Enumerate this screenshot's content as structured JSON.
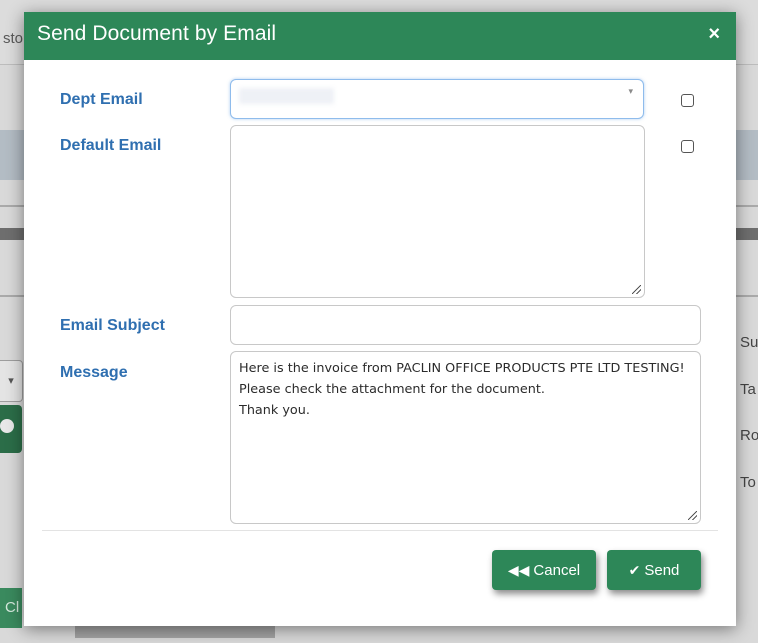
{
  "background": {
    "topbar_text": "sto",
    "side_labels": [
      "Su",
      "Ta",
      "Ro",
      "To"
    ],
    "bottom_button_text": "Cl",
    "select_caret": "▾"
  },
  "dialog": {
    "title": "Send Document by Email",
    "close_glyph": "×",
    "fields": {
      "dept_email": {
        "label": "Dept Email",
        "value": ""
      },
      "default_email": {
        "label": "Default Email",
        "value": ""
      },
      "email_subject": {
        "label": "Email Subject",
        "value": ""
      },
      "message": {
        "label": "Message",
        "value": "Here is the invoice  from PACLIN OFFICE PRODUCTS PTE LTD TESTING!\nPlease check the attachment for the document.\nThank you."
      }
    },
    "buttons": {
      "cancel": {
        "label": "Cancel",
        "icon": "double-chevron-left-icon",
        "glyph": "◀◀"
      },
      "send": {
        "label": "Send",
        "icon": "check-icon",
        "glyph": "✔"
      }
    },
    "colors": {
      "header": "#2d8758",
      "label": "#2f6fb0",
      "button": "#2d8758"
    }
  }
}
